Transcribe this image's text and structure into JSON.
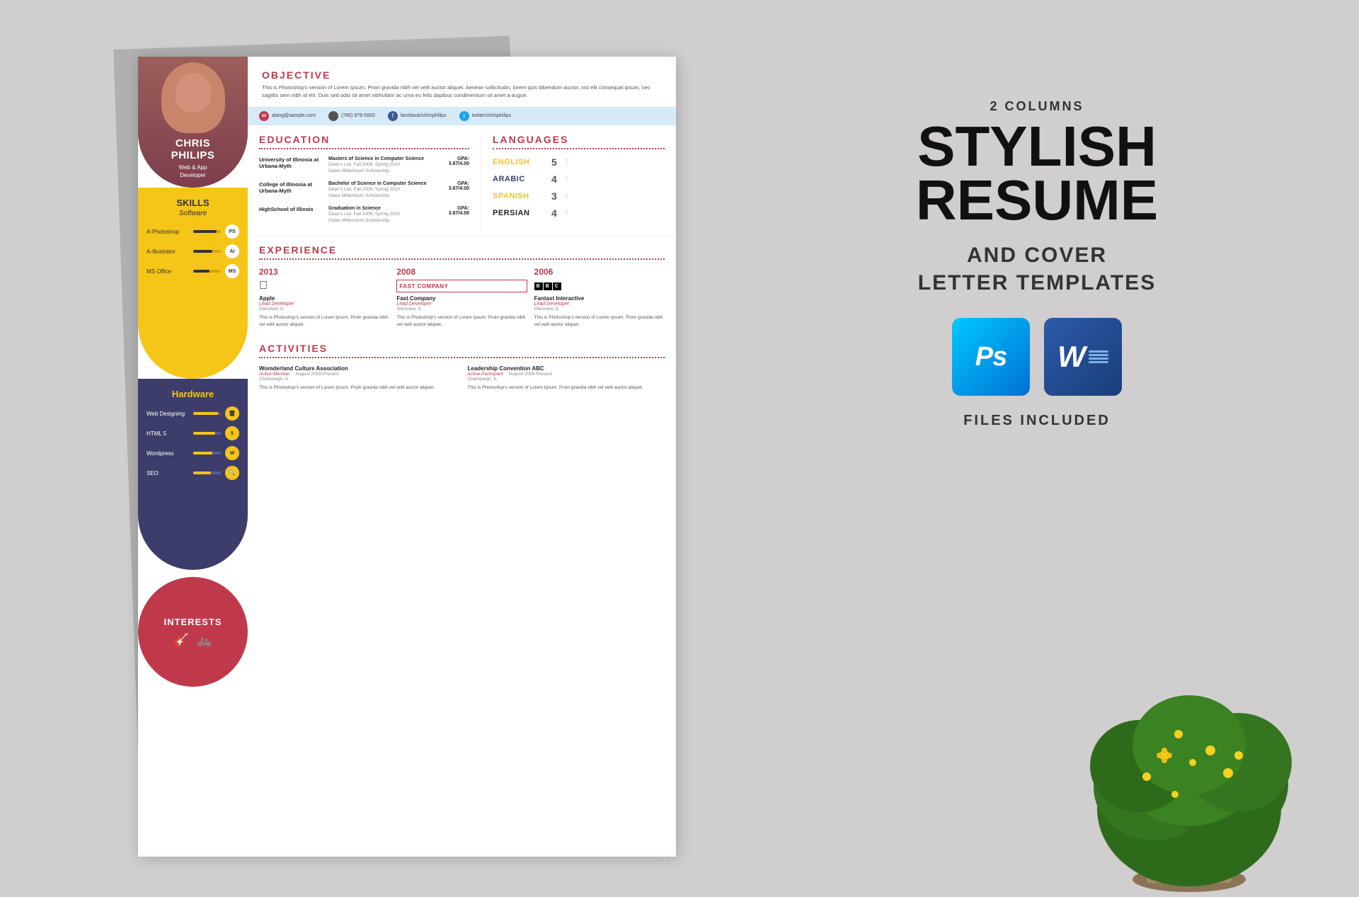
{
  "background_color": "#d0cece",
  "resume": {
    "profile": {
      "name": "CHRIS\nPHILIPS",
      "title": "Web & App\nDeveloper",
      "photo_alt": "Chris Philips profile photo"
    },
    "skills": {
      "title": "SKILLS",
      "subtitle": "Software",
      "items": [
        {
          "label": "A-Photoshop",
          "badge": "PS",
          "fill_pct": 85
        },
        {
          "label": "A-Illustrator",
          "badge": "AI",
          "fill_pct": 70
        },
        {
          "label": "MS Office",
          "badge": "MS",
          "fill_pct": 60
        }
      ]
    },
    "hardware": {
      "title": "Hardware",
      "items": [
        {
          "label": "Web Designing",
          "badge": "🖥",
          "fill_pct": 90
        },
        {
          "label": "HTML 5",
          "badge": "5",
          "fill_pct": 80
        },
        {
          "label": "Wordpress",
          "badge": "W",
          "fill_pct": 70
        },
        {
          "label": "SEO",
          "badge": "🔍",
          "fill_pct": 65
        }
      ]
    },
    "interests": {
      "title": "INTERESTS",
      "icons": [
        "🎸",
        "🚲"
      ]
    },
    "objective": {
      "title": "OBJECTIVE",
      "text": "This is Photoshop's version  of Lorem Ipsum. Proin gravida nibh vel velit auctor aliquet. Aenean sollicitudin, lorem quis bibendum auctor, nisi elit consequat ipsum, nec sagittis sem nibh id elit. Duis sed odio sit amet nibhullam ac urna eu felis dapibus condimentum sit amet a augue."
    },
    "contact": {
      "email": "alang@sample.com",
      "phone": "(785) 979-5555",
      "facebook": "facebook/chrisphilips",
      "twitter": "twitter/chrisphilips"
    },
    "education": {
      "title": "EDUCATION",
      "entries": [
        {
          "school": "University of Illinosia at Urbana-Myth",
          "degree": "Masters of Science in Computer Science",
          "subtext": "Dean's List: Fall 2009, Spring 2010\nGates Millennium Scholarship",
          "gpa": "GPA:\n3.67/4.00"
        },
        {
          "school": "College of Illinosia at Urbana-Myth",
          "degree": "Bachelor of Science in Computer Science",
          "subtext": "Dean's List: Fall 2009, Spring 2010\nGates Millennium Scholarship",
          "gpa": "GPA:\n3.67/4.00"
        },
        {
          "school": "HighSchool of Illinois",
          "degree": "Graduation in Science",
          "subtext": "Dean's List: Fall 2009, Spring 2010\nGates Millennium Scholarship",
          "gpa": "GPA:\n3.67/4.00"
        }
      ]
    },
    "languages": {
      "title": "LANGUAGES",
      "entries": [
        {
          "name": "ENGLISH",
          "score": 5,
          "color": "yellow"
        },
        {
          "name": "ARABIC",
          "score": 4,
          "color": "dark"
        },
        {
          "name": "SPANISH",
          "score": 3,
          "color": "yellow"
        },
        {
          "name": "PERSIAN",
          "score": 4,
          "color": "dark"
        }
      ]
    },
    "experience": {
      "title": "EXPERIENCE",
      "entries": [
        {
          "year": "2013",
          "logo_type": "apple",
          "company": "Apple",
          "role": "Lead Developer",
          "location": "Glenview, IL",
          "text": "This is Photoshop's version of Lorem Ipsum. Proin gravida nibh vel velit auctor aliquet."
        },
        {
          "year": "2008",
          "logo_type": "fastcompany",
          "company": "Fast Company",
          "role": "Lead Developer",
          "location": "Glenview, IL",
          "text": "This is Photoshop's version of Lorem Ipsum. Proin gravida nibh vel velit auctor aliquet."
        },
        {
          "year": "2006",
          "logo_type": "bbc",
          "company": "Fantast Interactive",
          "role": "Lead Developer",
          "location": "Glenview, IL",
          "text": "This is Photoshop's version of Lorem Ipsum. Proin gravida nibh vel velit auctor aliquet."
        }
      ]
    },
    "activities": {
      "title": "ACTIVITIES",
      "entries": [
        {
          "org": "Womderland Culture Association",
          "role": "Active Member",
          "date": "August 2009-Present",
          "location": "Champaign, IL",
          "text": "This is Photoshop's version of Lorem Ipsum. Proin gravida nibh vel velit auctor aliquet."
        },
        {
          "org": "Leadership Convention ABC",
          "role": "Active Participant",
          "date": "August 2009-Present",
          "location": "Champaign, IL",
          "text": "This is Photoshop's version  of Lorem Ipsum. Proin gravida nibh vel velit auctor aliquet."
        }
      ]
    }
  },
  "marketing": {
    "tag": "2 COLUMNS",
    "title_line1": "STYLISH",
    "title_line2": "RESUME",
    "subtitle_line1": "AND COVER",
    "subtitle_line2": "LETTER TEMPLATES",
    "ps_label": "Ps",
    "word_label": "W",
    "files_included": "FILES INCLUDED"
  }
}
